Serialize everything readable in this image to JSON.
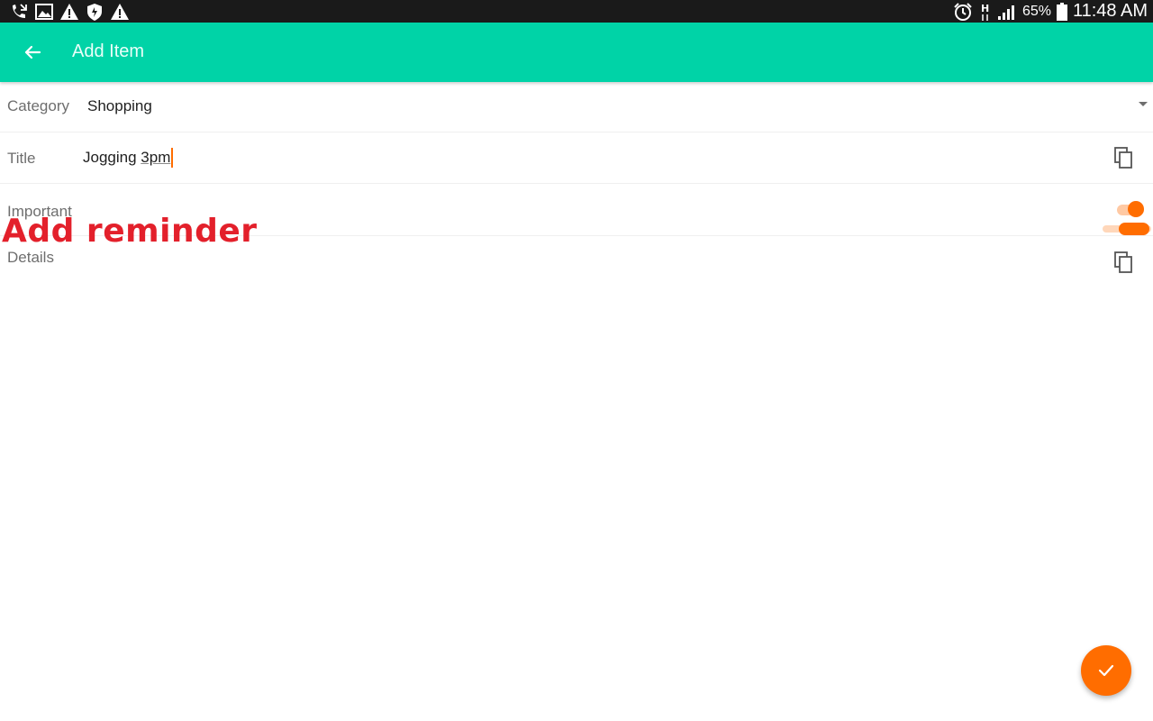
{
  "status_bar": {
    "left_icons": [
      "missed-call-icon",
      "image-icon",
      "warning-icon",
      "shield-icon",
      "warning-icon"
    ],
    "right_icons": [
      "alarm-icon",
      "network-h-icon",
      "signal-icon",
      "battery-icon"
    ],
    "battery_percent": "65%",
    "time": "11:48 AM"
  },
  "app_bar": {
    "title": "Add Item",
    "background_color": "#00d3a7"
  },
  "form": {
    "category": {
      "label": "Category",
      "value": "Shopping"
    },
    "title": {
      "label": "Title",
      "value_prefix": "Jogging ",
      "value_underlined": "3pm"
    },
    "important": {
      "label": "Important",
      "checked": true
    },
    "details": {
      "label": "Details",
      "value": ""
    }
  },
  "overlay_caption": "Add reminder",
  "fab": {
    "icon": "check-icon",
    "color": "#ff6d00"
  },
  "accent_color": "#ff6d00"
}
